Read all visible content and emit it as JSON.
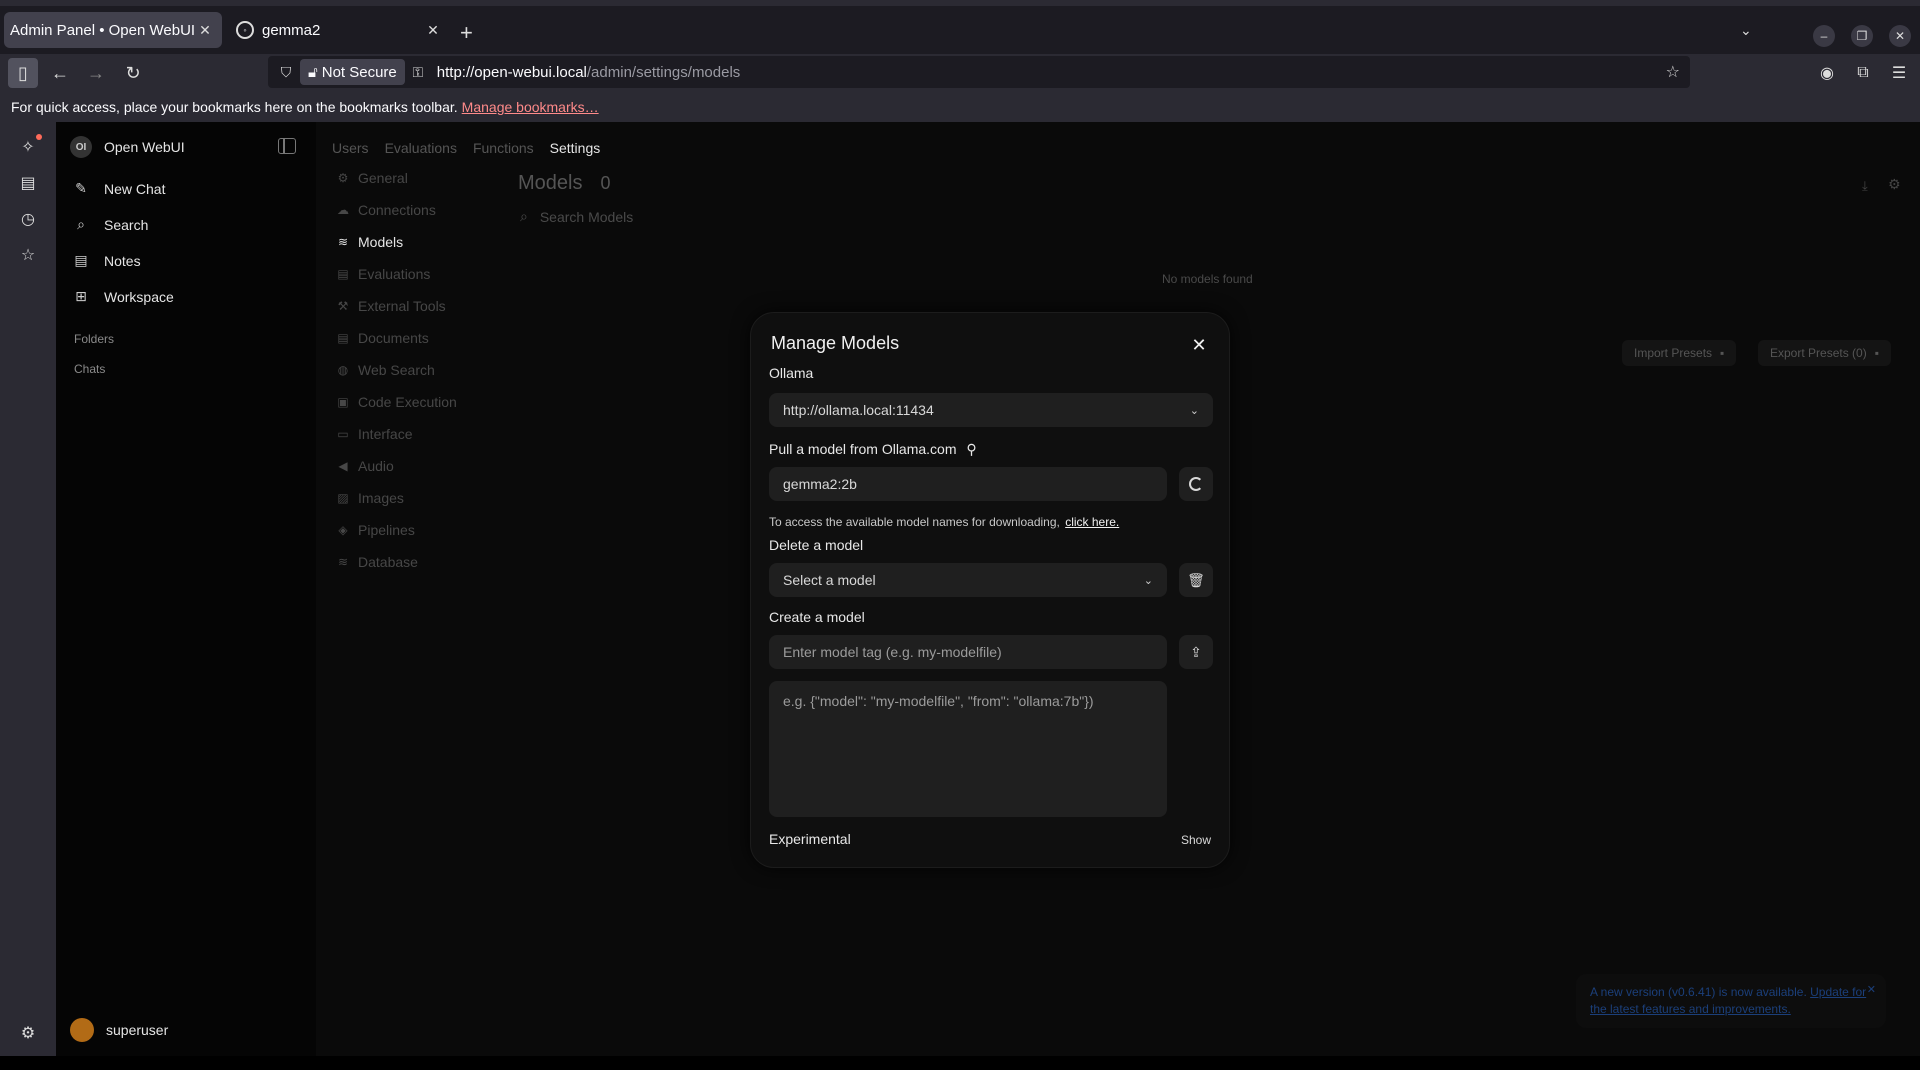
{
  "browser": {
    "tabs": [
      {
        "title": "Admin Panel • Open WebUI",
        "active": true
      },
      {
        "title": "gemma2",
        "active": false
      }
    ],
    "url_host": "http://open-webui.local",
    "url_path": "/admin/settings/models",
    "security_label": "Not Secure",
    "bookmarks_text": "For quick access, place your bookmarks here on the bookmarks toolbar.",
    "bookmarks_link": "Manage bookmarks…",
    "icons": [
      "sidebar-icon",
      "back-icon",
      "forward-icon",
      "reload-icon",
      "shield-icon",
      "lock-icon",
      "key-icon",
      "star-icon",
      "account-icon",
      "extensions-icon",
      "menu-icon"
    ]
  },
  "sidebar": {
    "brand": "Open WebUI",
    "logo_text": "OI",
    "items": [
      {
        "label": "New Chat",
        "icon": "pencil-icon"
      },
      {
        "label": "Search",
        "icon": "search-icon"
      },
      {
        "label": "Notes",
        "icon": "notes-icon"
      },
      {
        "label": "Workspace",
        "icon": "workspace-icon"
      }
    ],
    "sections": [
      "Folders",
      "Chats"
    ],
    "user": "superuser"
  },
  "admin": {
    "tabs": [
      "Users",
      "Evaluations",
      "Functions",
      "Settings"
    ],
    "active_tab": "Settings",
    "settings_nav": [
      "General",
      "Connections",
      "Models",
      "Evaluations",
      "External Tools",
      "Documents",
      "Web Search",
      "Code Execution",
      "Interface",
      "Audio",
      "Images",
      "Pipelines",
      "Database"
    ],
    "active_settings": "Models"
  },
  "models": {
    "title": "Models",
    "count": "0",
    "search_placeholder": "Search Models",
    "empty_text": "No models found",
    "import_presets": "Import Presets",
    "export_presets": "Export Presets (0)"
  },
  "modal": {
    "title": "Manage Models",
    "provider": "Ollama",
    "ollama_url": "http://ollama.local:11434",
    "pull_label": "Pull a model from Ollama.com",
    "pull_value": "gemma2:2b",
    "help_text": "To access the available model names for downloading,",
    "help_link": "click here.",
    "delete_label": "Delete a model",
    "delete_placeholder": "Select a model",
    "create_label": "Create a model",
    "create_placeholder": "Enter model tag (e.g. my-modelfile)",
    "modelfile_placeholder": "e.g. {\"model\": \"my-modelfile\", \"from\": \"ollama:7b\"})",
    "experimental_label": "Experimental",
    "show_label": "Show"
  },
  "toast": {
    "text": "A new version (v0.6.41) is now available.",
    "link": "Update for the latest features and improvements."
  },
  "colors": {
    "browser_chrome": "#2b2a33",
    "tab_active": "#42414d",
    "app_background": "#0a0a0a",
    "modal_field": "#1f1f1f",
    "avatar": "#b26b16",
    "toast_text": "#1b3f7a"
  }
}
